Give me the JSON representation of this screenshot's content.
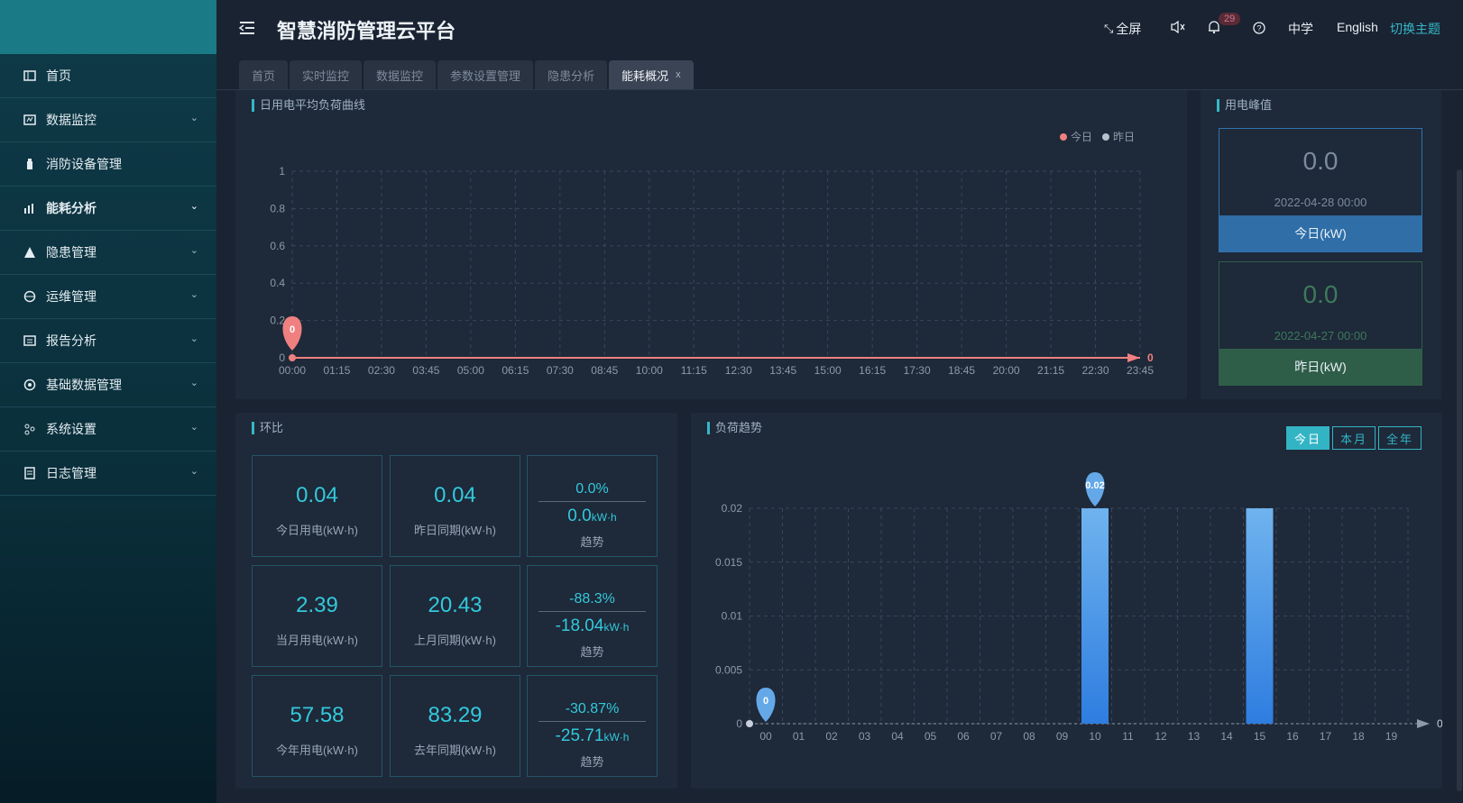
{
  "app": {
    "title": "智慧消防管理云平台"
  },
  "sidebar": {
    "items": [
      {
        "label": "首页"
      },
      {
        "label": "数据监控"
      },
      {
        "label": "消防设备管理"
      },
      {
        "label": "能耗分析"
      },
      {
        "label": "隐患管理"
      },
      {
        "label": "运维管理"
      },
      {
        "label": "报告分析"
      },
      {
        "label": "基础数据管理"
      },
      {
        "label": "系统设置"
      },
      {
        "label": "日志管理"
      }
    ]
  },
  "header": {
    "fullscreen": "全屏",
    "notification_count": "29",
    "lang_cn": "中学",
    "lang_en": "English",
    "switch_theme": "切换主题"
  },
  "tabs": [
    {
      "label": "首页"
    },
    {
      "label": "实时监控"
    },
    {
      "label": "数据监控"
    },
    {
      "label": "参数设置管理"
    },
    {
      "label": "隐患分析"
    },
    {
      "label": "能耗概况",
      "close": "x"
    }
  ],
  "daily_curve": {
    "title": "日用电平均负荷曲线",
    "legend_today": "今日",
    "legend_yesterday": "昨日"
  },
  "peak": {
    "title": "用电峰值",
    "today": {
      "value": "0.0",
      "date": "2022-04-28 00:00",
      "label": "今日(kW)"
    },
    "yesterday": {
      "value": "0.0",
      "date": "2022-04-27 00:00",
      "label": "昨日(kW)"
    }
  },
  "ratio": {
    "title": "环比",
    "rows": [
      {
        "v1": "0.04",
        "l1": "今日用电(kW·h)",
        "v2": "0.04",
        "l2": "昨日同期(kW·h)",
        "pct": "0.0%",
        "diff": "0.0",
        "unit": "kW·h",
        "trend": "趋势"
      },
      {
        "v1": "2.39",
        "l1": "当月用电(kW·h)",
        "v2": "20.43",
        "l2": "上月同期(kW·h)",
        "pct": "-88.3%",
        "diff": "-18.04",
        "unit": "kW·h",
        "trend": "趋势"
      },
      {
        "v1": "57.58",
        "l1": "今年用电(kW·h)",
        "v2": "83.29",
        "l2": "去年同期(kW·h)",
        "pct": "-30.87%",
        "diff": "-25.71",
        "unit": "kW·h",
        "trend": "趋势"
      }
    ]
  },
  "load_trend": {
    "title": "负荷趋势",
    "btn_today": "今日",
    "btn_month": "本月",
    "btn_year": "全年"
  },
  "colors": {
    "accent": "#33c9dc",
    "today_line": "#f08080",
    "bar": "#3a8ee6",
    "today_card": "#2f6ea7",
    "yesterday_card": "#2f5e48"
  },
  "chart_data": [
    {
      "type": "line",
      "title": "日用电平均负荷曲线",
      "x": [
        "00:00",
        "01:15",
        "02:30",
        "03:45",
        "05:00",
        "06:15",
        "07:30",
        "08:45",
        "10:00",
        "11:15",
        "12:30",
        "13:45",
        "15:00",
        "16:15",
        "17:30",
        "18:45",
        "20:00",
        "21:15",
        "22:30",
        "23:45"
      ],
      "series": [
        {
          "name": "今日",
          "values": [
            0,
            0,
            0,
            0,
            0,
            0,
            0,
            0,
            0,
            0,
            0,
            0,
            0,
            0,
            0,
            0,
            0,
            0,
            0,
            0
          ]
        }
      ],
      "ylim": [
        0,
        1
      ],
      "yticks": [
        0,
        0.2,
        0.4,
        0.6,
        0.8,
        1
      ],
      "annotations": [
        {
          "label": "0",
          "x": "00:00"
        },
        {
          "label": "0",
          "x": "23:45"
        }
      ],
      "legend": [
        "今日",
        "昨日"
      ],
      "legend_position": "top-right",
      "grid": true
    },
    {
      "type": "bar",
      "title": "负荷趋势",
      "categories": [
        "00",
        "01",
        "02",
        "03",
        "04",
        "05",
        "06",
        "07",
        "08",
        "09",
        "10",
        "11",
        "12",
        "13",
        "14",
        "15",
        "16",
        "17",
        "18",
        "19"
      ],
      "values": [
        0,
        0,
        0,
        0,
        0,
        0,
        0,
        0,
        0,
        0,
        0.02,
        0,
        0,
        0,
        0,
        0.02,
        0,
        0,
        0,
        0
      ],
      "ylim": [
        0,
        0.02
      ],
      "yticks": [
        0,
        0.005,
        0.01,
        0.015,
        0.02
      ],
      "annotations": [
        {
          "label": "0.02",
          "x": "10"
        },
        {
          "label": "0",
          "x": "00"
        },
        {
          "label": "0",
          "x": "end"
        }
      ],
      "grid": true
    }
  ]
}
